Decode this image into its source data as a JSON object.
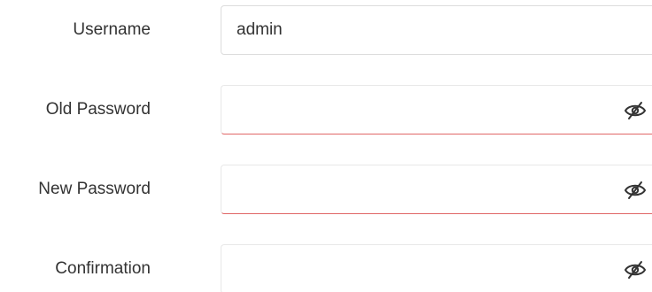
{
  "form": {
    "username": {
      "label": "Username",
      "value": "admin",
      "placeholder": ""
    },
    "old_password": {
      "label": "Old Password",
      "value": "",
      "placeholder": "",
      "toggle_icon": "eye-slash-icon"
    },
    "new_password": {
      "label": "New Password",
      "value": "",
      "placeholder": "",
      "toggle_icon": "eye-slash-icon"
    },
    "confirmation": {
      "label": "Confirmation",
      "value": "",
      "placeholder": "",
      "toggle_icon": "eye-slash-icon"
    }
  },
  "colors": {
    "label_text": "#333333",
    "field_border": "#dcdcdc",
    "error_underline": "#e06666",
    "icon": "#333333"
  }
}
